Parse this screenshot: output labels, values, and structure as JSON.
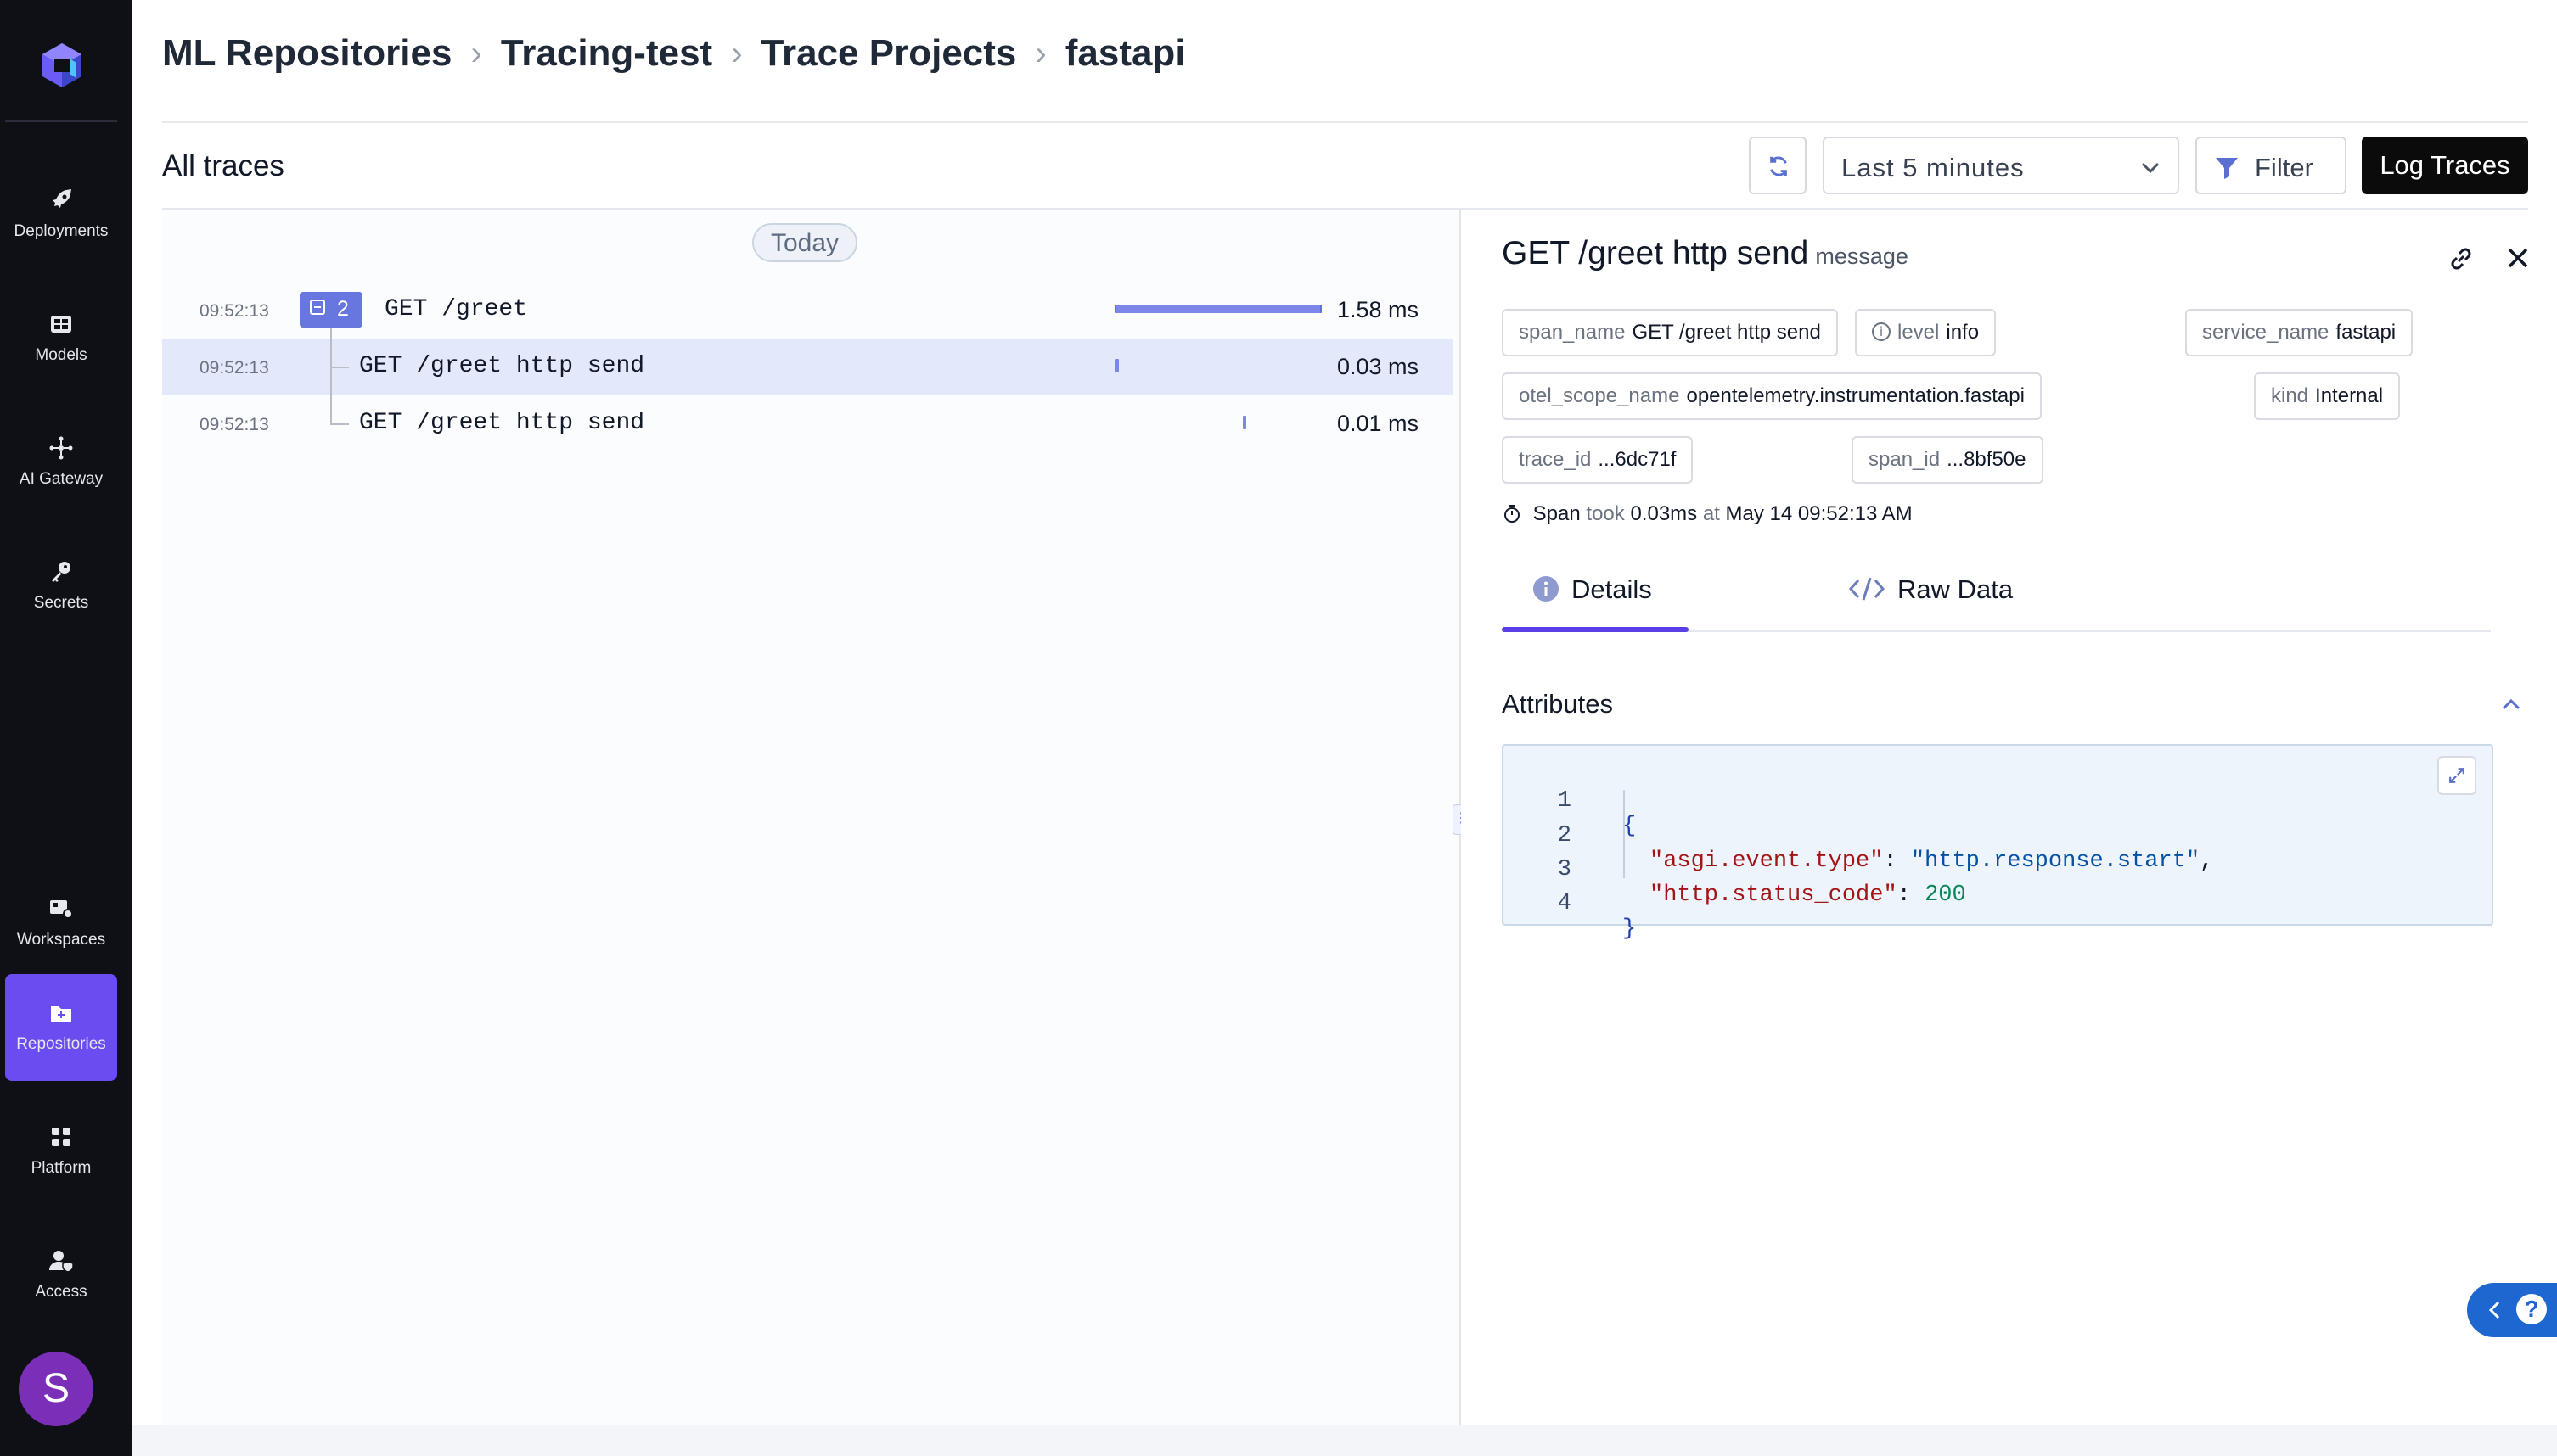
{
  "sidebar": {
    "items": [
      {
        "label": "Deployments",
        "icon": "rocket-icon"
      },
      {
        "label": "Models",
        "icon": "grid-icon"
      },
      {
        "label": "AI Gateway",
        "icon": "network-icon"
      },
      {
        "label": "Secrets",
        "icon": "key-icon"
      },
      {
        "label": "Workspaces",
        "icon": "workspaces-icon"
      },
      {
        "label": "Repositories",
        "icon": "folder-icon"
      },
      {
        "label": "Platform",
        "icon": "apps-icon"
      },
      {
        "label": "Access",
        "icon": "user-shield-icon"
      }
    ],
    "active": "Repositories",
    "avatar_initial": "S"
  },
  "breadcrumb": [
    "ML Repositories",
    "Tracing-test",
    "Trace Projects",
    "fastapi"
  ],
  "header": {
    "title": "All traces",
    "time_range": "Last 5 minutes",
    "filter_label": "Filter",
    "log_button": "Log Traces"
  },
  "traces": {
    "date_group": "Today",
    "rows": [
      {
        "time": "09:52:13",
        "name": "GET /greet",
        "duration": "1.58 ms",
        "children_count": "2",
        "bar_start": 0.0,
        "bar_fraction": 1.0
      },
      {
        "time": "09:52:13",
        "name": "GET /greet http send",
        "duration": "0.03 ms",
        "bar_start": 0.0,
        "bar_fraction": 0.02
      },
      {
        "time": "09:52:13",
        "name": "GET /greet http send",
        "duration": "0.01 ms",
        "bar_start": 0.63,
        "bar_fraction": 0.01
      }
    ],
    "selected_index": 1
  },
  "detail": {
    "title": "GET /greet http send",
    "subtitle": "message",
    "chips": [
      {
        "key": "span_name",
        "value": "GET /greet http send"
      },
      {
        "key": "level",
        "value": "info"
      },
      {
        "key": "service_name",
        "value": "fastapi"
      },
      {
        "key": "otel_scope_name",
        "value": "opentelemetry.instrumentation.fastapi"
      },
      {
        "key": "kind",
        "value": "Internal"
      },
      {
        "key": "trace_id",
        "value": "...6dc71f"
      },
      {
        "key": "span_id",
        "value": "...8bf50e"
      }
    ],
    "span_summary": {
      "label": "Span",
      "took_word": "took",
      "duration": "0.03ms",
      "at_word": "at",
      "timestamp": "May 14 09:52:13 AM"
    },
    "tabs": [
      {
        "label": "Details",
        "icon": "info-icon"
      },
      {
        "label": "Raw Data",
        "icon": "code-icon"
      }
    ],
    "active_tab": "Details",
    "attributes_title": "Attributes",
    "code": {
      "line_numbers": [
        "1",
        "2",
        "3",
        "4"
      ],
      "open_brace": "{",
      "key1": "\"asgi.event.type\"",
      "value1": "\"http.response.start\"",
      "key2": "\"http.status_code\"",
      "value2": "200",
      "close_brace": "}",
      "colon": ":",
      "comma": ","
    }
  },
  "colors": {
    "accent": "#5b3fe6",
    "sidebar_bg": "#0f1016",
    "active_nav": "#6a4cf0",
    "selected_row": "#e3e8fb",
    "timing_bar": "#7b86e8",
    "help_button": "#1e66d0"
  },
  "help_label": "?"
}
